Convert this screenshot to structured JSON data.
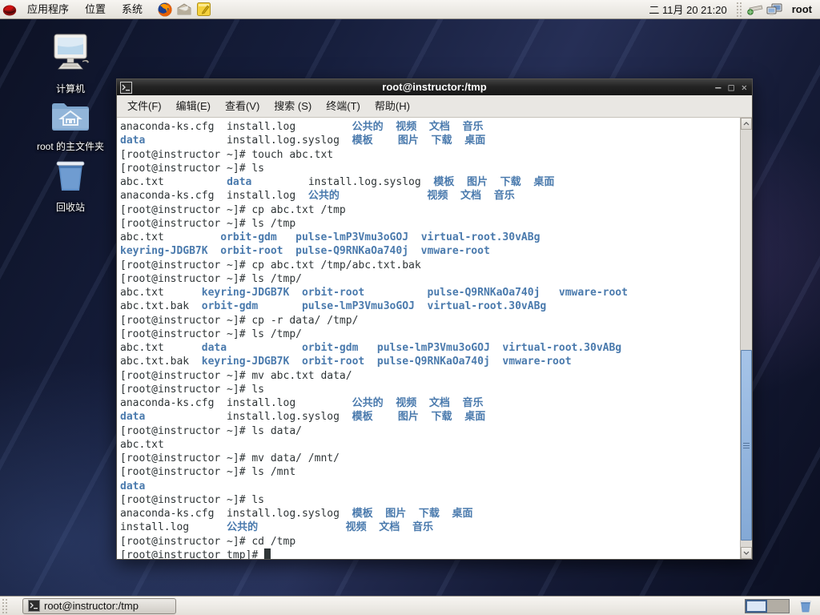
{
  "top_panel": {
    "menus": [
      "应用程序",
      "位置",
      "系统"
    ],
    "launcher_icons": [
      "redhat-menu-icon",
      "firefox-icon",
      "email-icon",
      "notes-icon"
    ],
    "clock": "二 11月 20 21:20",
    "indicator_icons": [
      "keyboard-indicator-icon",
      "display-settings-icon"
    ],
    "user": "root"
  },
  "desktop": {
    "icons": [
      {
        "name": "computer",
        "label": "计算机"
      },
      {
        "name": "home-folder",
        "label": "root 的主文件夹"
      },
      {
        "name": "trash",
        "label": "回收站"
      }
    ]
  },
  "window": {
    "title": "root@instructor:/tmp",
    "menu_items": [
      "文件(F)",
      "编辑(E)",
      "查看(V)",
      "搜索 (S)",
      "终端(T)",
      "帮助(H)"
    ],
    "controls": [
      "minimize-icon",
      "maximize-icon",
      "close-icon"
    ]
  },
  "terminal": {
    "colors": {
      "fg": "#2e3436",
      "dir": "#4a7aad",
      "bg": "#ffffff"
    },
    "lines": [
      [
        [
          "anaconda-ks.cfg  install.log         ",
          "f"
        ],
        [
          "公共的  视频  文档  音乐",
          "d"
        ]
      ],
      [
        [
          "data",
          "d"
        ],
        [
          "             install.log.syslog  ",
          "f"
        ],
        [
          "模板    图片  下载  桌面",
          "d"
        ]
      ],
      [
        [
          "[root@instructor ~]# touch abc.txt",
          "f"
        ]
      ],
      [
        [
          "[root@instructor ~]# ls",
          "f"
        ]
      ],
      [
        [
          "abc.txt          ",
          "f"
        ],
        [
          "data",
          "d"
        ],
        [
          "         install.log.syslog  ",
          "f"
        ],
        [
          "模板  图片  下载  桌面",
          "d"
        ]
      ],
      [
        [
          "anaconda-ks.cfg  install.log  ",
          "f"
        ],
        [
          "公共的",
          "d"
        ],
        [
          "              ",
          "f"
        ],
        [
          "视频  文档  音乐",
          "d"
        ]
      ],
      [
        [
          "[root@instructor ~]# cp abc.txt /tmp",
          "f"
        ]
      ],
      [
        [
          "[root@instructor ~]# ls /tmp",
          "f"
        ]
      ],
      [
        [
          "abc.txt         ",
          "f"
        ],
        [
          "orbit-gdm   pulse-lmP3Vmu3oGOJ  virtual-root.30vABg",
          "d"
        ]
      ],
      [
        [
          "keyring-JDGB7K  orbit-root  pulse-Q9RNKaOa740j  vmware-root",
          "d"
        ]
      ],
      [
        [
          "[root@instructor ~]# cp abc.txt /tmp/abc.txt.bak",
          "f"
        ]
      ],
      [
        [
          "[root@instructor ~]# ls /tmp/",
          "f"
        ]
      ],
      [
        [
          "abc.txt      ",
          "f"
        ],
        [
          "keyring-JDGB7K  orbit-root          pulse-Q9RNKaOa740j   vmware-root",
          "d"
        ]
      ],
      [
        [
          "abc.txt.bak  ",
          "f"
        ],
        [
          "orbit-gdm       pulse-lmP3Vmu3oGOJ  virtual-root.30vABg",
          "d"
        ]
      ],
      [
        [
          "[root@instructor ~]# cp -r data/ /tmp/",
          "f"
        ]
      ],
      [
        [
          "[root@instructor ~]# ls /tmp/",
          "f"
        ]
      ],
      [
        [
          "abc.txt      ",
          "f"
        ],
        [
          "data            orbit-gdm   pulse-lmP3Vmu3oGOJ  virtual-root.30vABg",
          "d"
        ]
      ],
      [
        [
          "abc.txt.bak  ",
          "f"
        ],
        [
          "keyring-JDGB7K  orbit-root  pulse-Q9RNKaOa740j  vmware-root",
          "d"
        ]
      ],
      [
        [
          "[root@instructor ~]# mv abc.txt data/",
          "f"
        ]
      ],
      [
        [
          "[root@instructor ~]# ls",
          "f"
        ]
      ],
      [
        [
          "anaconda-ks.cfg  install.log         ",
          "f"
        ],
        [
          "公共的  视频  文档  音乐",
          "d"
        ]
      ],
      [
        [
          "data",
          "d"
        ],
        [
          "             install.log.syslog  ",
          "f"
        ],
        [
          "模板    图片  下载  桌面",
          "d"
        ]
      ],
      [
        [
          "[root@instructor ~]# ls data/",
          "f"
        ]
      ],
      [
        [
          "abc.txt",
          "f"
        ]
      ],
      [
        [
          "[root@instructor ~]# mv data/ /mnt/",
          "f"
        ]
      ],
      [
        [
          "[root@instructor ~]# ls /mnt",
          "f"
        ]
      ],
      [
        [
          "data",
          "d"
        ]
      ],
      [
        [
          "[root@instructor ~]# ls",
          "f"
        ]
      ],
      [
        [
          "anaconda-ks.cfg  install.log.syslog  ",
          "f"
        ],
        [
          "模板  图片  下载  桌面",
          "d"
        ]
      ],
      [
        [
          "install.log      ",
          "f"
        ],
        [
          "公共的",
          "d"
        ],
        [
          "              ",
          "f"
        ],
        [
          "视频  文档  音乐",
          "d"
        ]
      ],
      [
        [
          "[root@instructor ~]# cd /tmp",
          "f"
        ]
      ],
      [
        [
          "[root@instructor tmp]# ",
          "f"
        ],
        [
          "█",
          "f"
        ]
      ]
    ]
  },
  "taskbar": {
    "window_button": "root@instructor:/tmp",
    "workspaces": 2,
    "active_workspace": 1
  }
}
